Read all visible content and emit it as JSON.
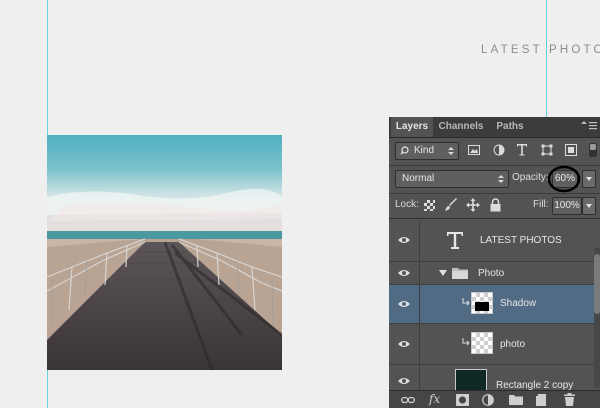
{
  "canvas": {
    "heading": "LATEST PHOTO"
  },
  "layers_panel": {
    "tabs": [
      {
        "label": "Layers",
        "active": true
      },
      {
        "label": "Channels",
        "active": false
      },
      {
        "label": "Paths",
        "active": false
      }
    ],
    "filter": {
      "label": "Kind"
    },
    "blend_mode": "Normal",
    "opacity": {
      "label": "Opacity:",
      "value": "60%"
    },
    "lock": {
      "label": "Lock:"
    },
    "fill": {
      "label": "Fill:",
      "value": "100%"
    },
    "layers": [
      {
        "name": "LATEST PHOTOS",
        "type": "text"
      },
      {
        "name": "Photo",
        "type": "group"
      },
      {
        "name": "Shadow",
        "type": "clipping",
        "selected": true
      },
      {
        "name": "photo",
        "type": "clipping"
      },
      {
        "name": "Rectangle 2 copy",
        "type": "shape"
      }
    ],
    "bottom_icons": [
      "link-icon",
      "fx-icon",
      "mask-icon",
      "adjustment-icon",
      "folder-icon",
      "new-layer-icon",
      "trash-icon"
    ]
  },
  "colors": {
    "guide": "#5fd6e2",
    "panel_bg": "#535353",
    "selected_layer": "#516b85",
    "highlight_circle": "#000000"
  }
}
